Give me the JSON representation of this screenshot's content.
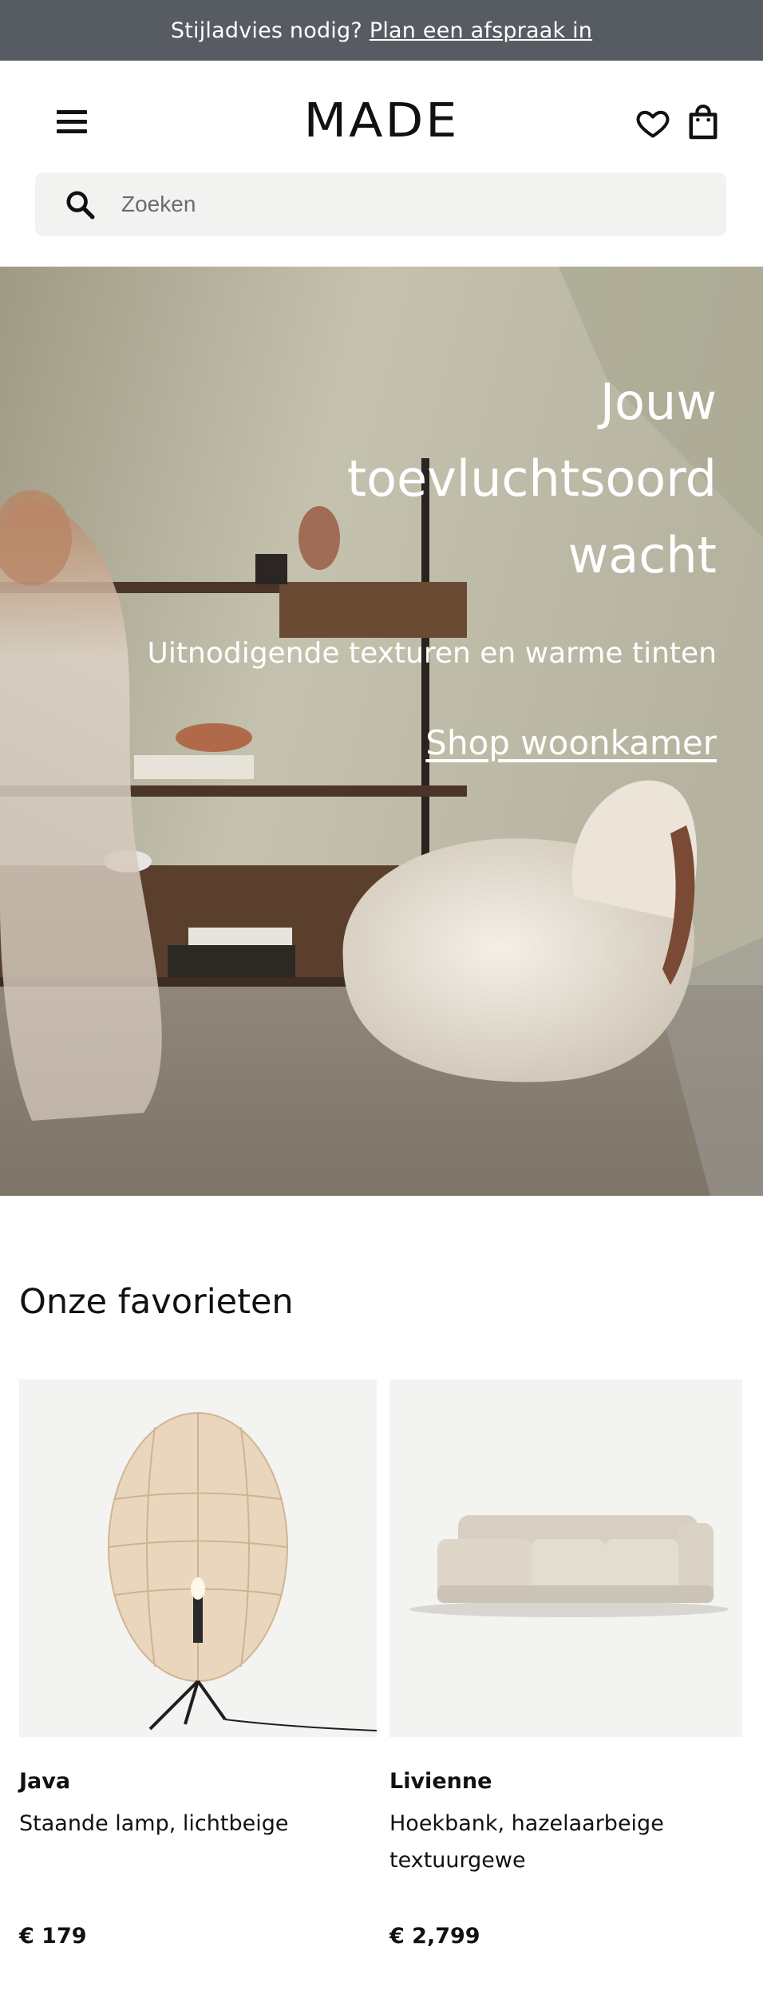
{
  "promo": {
    "text": "Stijladvies nodig?",
    "link": "Plan een afspraak in"
  },
  "header": {
    "logo": "MADE",
    "icons": [
      "menu-icon",
      "heart-icon",
      "bag-icon"
    ]
  },
  "search": {
    "placeholder": "Zoeken",
    "icon": "search-icon"
  },
  "hero": {
    "title_lines": [
      "Jouw",
      "toevluchtsoord",
      "wacht"
    ],
    "subtitle": "Uitnodigende texturen en warme tinten",
    "cta": "Shop woonkamer"
  },
  "favorites": {
    "title": "Onze favorieten",
    "products": [
      {
        "name": "Java",
        "description": "Staande lamp, lichtbeige",
        "price": "€ 179"
      },
      {
        "name": "Livienne",
        "description": "Hoekbank, hazelaarbeige textuurgewe",
        "price": "€ 2,799"
      }
    ]
  },
  "colors": {
    "promo_bg": "#575c62",
    "search_bg": "#f2f2f0",
    "product_bg": "#f3f3f1",
    "text": "#111111"
  }
}
